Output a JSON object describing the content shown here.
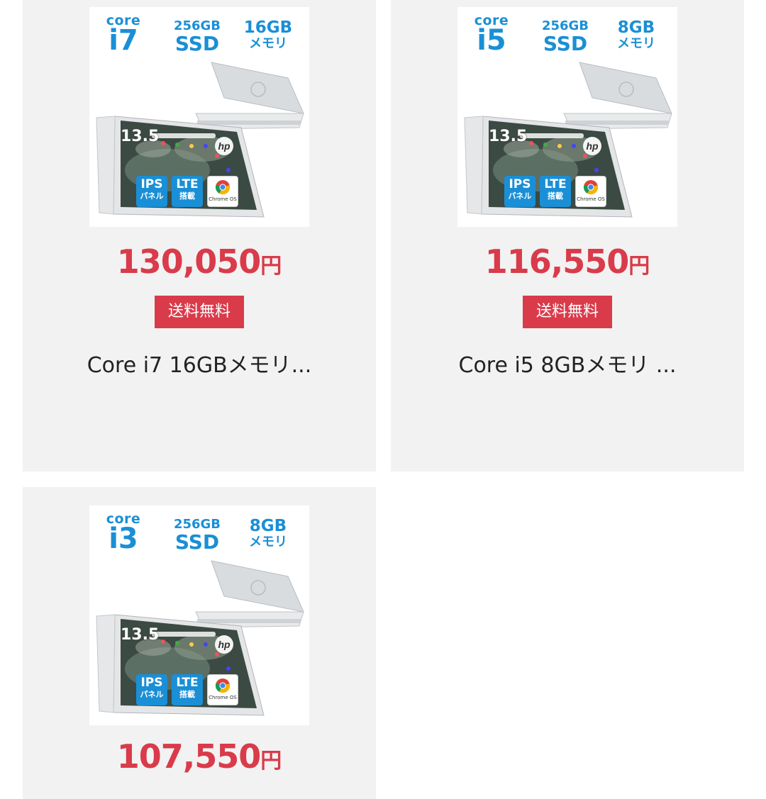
{
  "products": [
    {
      "cpu_label_small": "core",
      "cpu_label_big": "i7",
      "ssd_small": "256GB",
      "ssd_big": "SSD",
      "mem_small": "16GB",
      "mem_big": "メモリ",
      "screen_size": "13.5",
      "badge_ips": "IPS",
      "badge_ips_sub": "パネル",
      "badge_lte": "LTE",
      "badge_lte_sub": "搭載",
      "badge_chrome_sub": "Chrome OS",
      "price": "130,050",
      "currency": "円",
      "shipping": "送料無料",
      "title": "Core i7 16GBメモリ..."
    },
    {
      "cpu_label_small": "core",
      "cpu_label_big": "i5",
      "ssd_small": "256GB",
      "ssd_big": "SSD",
      "mem_small": "8GB",
      "mem_big": "メモリ",
      "screen_size": "13.5",
      "badge_ips": "IPS",
      "badge_ips_sub": "パネル",
      "badge_lte": "LTE",
      "badge_lte_sub": "搭載",
      "badge_chrome_sub": "Chrome OS",
      "price": "116,550",
      "currency": "円",
      "shipping": "送料無料",
      "title": "Core i5 8GBメモリ ..."
    },
    {
      "cpu_label_small": "core",
      "cpu_label_big": "i3",
      "ssd_small": "256GB",
      "ssd_big": "SSD",
      "mem_small": "8GB",
      "mem_big": "メモリ",
      "screen_size": "13.5",
      "badge_ips": "IPS",
      "badge_ips_sub": "パネル",
      "badge_lte": "LTE",
      "badge_lte_sub": "搭載",
      "badge_chrome_sub": "Chrome OS",
      "price": "107,550",
      "currency": "円"
    }
  ],
  "colors": {
    "price": "#d93b4a",
    "spec_blue": "#1a8fd6",
    "card_bg": "#f2f2f2"
  },
  "icons": [
    "hp-logo-icon",
    "chrome-icon",
    "laptop-image"
  ]
}
